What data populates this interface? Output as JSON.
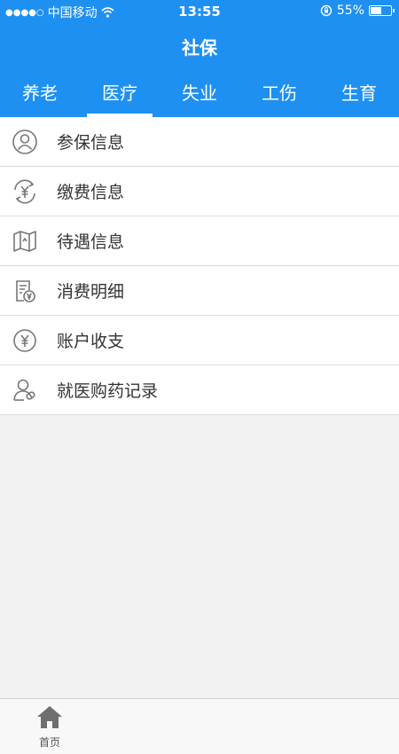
{
  "status_bar": {
    "signal": "●●●●○",
    "carrier": "中国移动",
    "time": "13:55",
    "battery_text": "55%",
    "battery_level": 0.55
  },
  "header": {
    "title": "社保"
  },
  "tabs": [
    {
      "label": "养老",
      "active": false
    },
    {
      "label": "医疗",
      "active": true
    },
    {
      "label": "失业",
      "active": false
    },
    {
      "label": "工伤",
      "active": false
    },
    {
      "label": "生育",
      "active": false
    }
  ],
  "menu": [
    {
      "label": "参保信息",
      "icon": "person-circle-icon"
    },
    {
      "label": "缴费信息",
      "icon": "yuan-refresh-icon"
    },
    {
      "label": "待遇信息",
      "icon": "map-icon"
    },
    {
      "label": "消费明细",
      "icon": "receipt-icon"
    },
    {
      "label": "账户收支",
      "icon": "yuan-circle-icon"
    },
    {
      "label": "就医购药记录",
      "icon": "user-pill-icon"
    }
  ],
  "tabbar": {
    "home_label": "首页"
  },
  "colors": {
    "primary": "#1e90f2",
    "icon": "#777777"
  }
}
